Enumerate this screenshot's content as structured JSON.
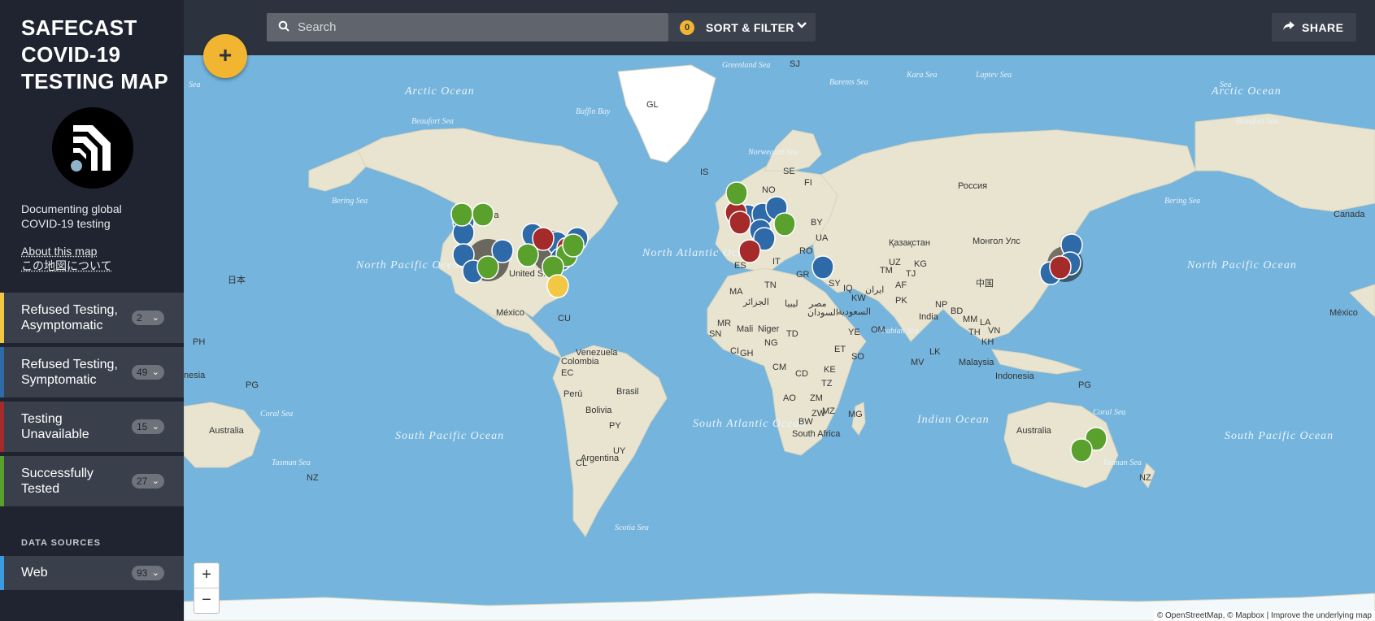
{
  "sidebar": {
    "title_lines": [
      "SAFECAST",
      "COVID-19",
      "TESTING MAP"
    ],
    "tagline": "Documenting global COVID-19 testing",
    "about_links": [
      "About this map",
      "この地図について"
    ],
    "categories": [
      {
        "label": "Refused Testing, Asymptomatic",
        "count": "2",
        "color": "#f2c744"
      },
      {
        "label": "Refused Testing, Symptomatic",
        "count": "49",
        "color": "#2f6aa8"
      },
      {
        "label": "Testing Unavailable",
        "count": "15",
        "color": "#a52a2a"
      },
      {
        "label": "Successfully Tested",
        "count": "27",
        "color": "#5aa02c"
      }
    ],
    "data_sources_heading": "DATA SOURCES",
    "data_sources": [
      {
        "label": "Web",
        "count": "93",
        "color": "#3b9be0"
      }
    ]
  },
  "topbar": {
    "search_placeholder": "Search",
    "filter_count": "0",
    "sort_filter_label": "SORT & FILTER",
    "share_label": "SHARE"
  },
  "map": {
    "add_label": "+",
    "zoom_in": "+",
    "zoom_out": "−",
    "attribution": "© OpenStreetMap, © Mapbox | Improve the underlying map",
    "ocean_labels": [
      "Arctic Ocean",
      "North Pacific Ocean",
      "North Atlantic Ocean",
      "South Pacific Ocean",
      "South Atlantic Ocean",
      "Indian Ocean",
      "Arctic Ocean",
      "North Pacific Ocean",
      "South Pacific Ocean"
    ],
    "sea_labels": [
      "Sea",
      "Greenland Sea",
      "Barents Sea",
      "Kara Sea",
      "Laptev Sea",
      "Beaufort Sea",
      "Baffin Bay",
      "Norwegian Sea",
      "Bering Sea",
      "Bering Sea",
      "Coral Sea",
      "Tasman Sea",
      "Arabian Sea",
      "Scotia Sea",
      "Coral Sea",
      "Tasman Sea",
      "Beaufort Sea",
      "Sea"
    ],
    "place_labels": [
      "GL",
      "SJ",
      "IS",
      "SE",
      "FI",
      "NO",
      "Россия",
      "Canada",
      "United States",
      "México",
      "CU",
      "日本",
      "PH",
      "Venezuela",
      "Colombia",
      "EC",
      "Perú",
      "Brasil",
      "Bolivia",
      "PY",
      "UY",
      "Argentina",
      "CL",
      "MA",
      "الجزائر",
      "ليبيا",
      "مصر",
      "Mali",
      "Niger",
      "TD",
      "السودان",
      "ET",
      "SO",
      "KE",
      "TZ",
      "CD",
      "CM",
      "AO",
      "ZM",
      "ZW",
      "MZ",
      "BW",
      "South Africa",
      "MG",
      "MR",
      "SN",
      "GH",
      "CI",
      "NG",
      "TN",
      "ES",
      "IT",
      "GR",
      "UA",
      "BY",
      "RO",
      "Қазақстан",
      "Монгол Улс",
      "中国",
      "India",
      "PK",
      "AF",
      "ایران",
      "IQ",
      "SY",
      "السعودية",
      "YE",
      "OM",
      "KW",
      "TM",
      "UZ",
      "KG",
      "TJ",
      "NP",
      "BD",
      "MM",
      "LA",
      "TH",
      "VN",
      "KH",
      "Malaysia",
      "Indonesia",
      "PG",
      "LK",
      "MV",
      "Australia",
      "NZ",
      "Canada",
      "México",
      "Australia",
      "NZ",
      "PG",
      "nesia"
    ]
  }
}
